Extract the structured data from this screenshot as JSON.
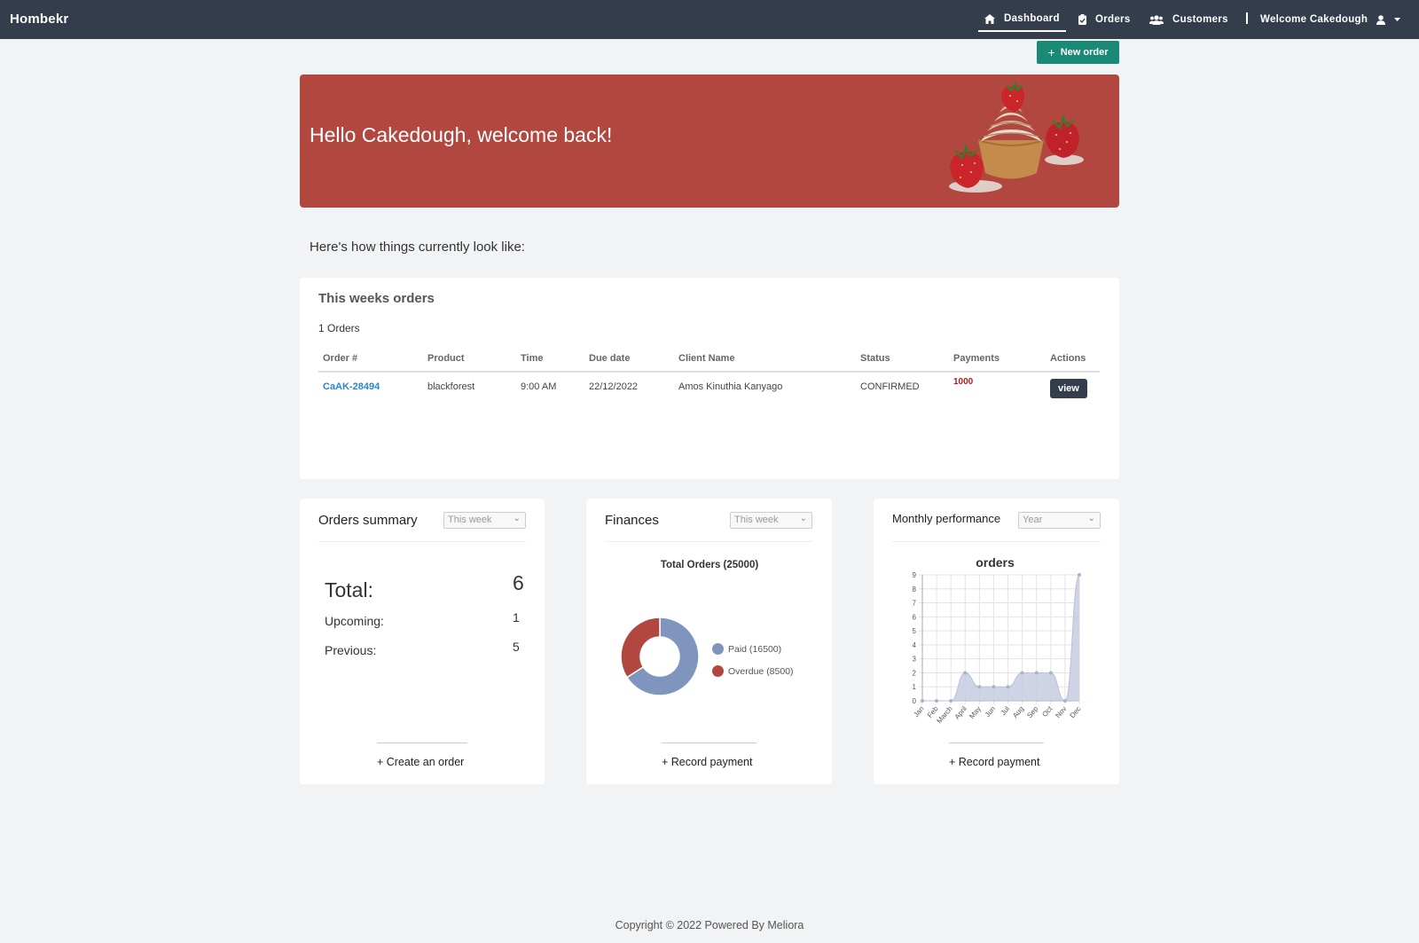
{
  "nav": {
    "brand": "Hombekr",
    "dashboard": "Dashboard",
    "orders": "Orders",
    "customers": "Customers",
    "welcome": "Welcome Cakedough"
  },
  "actions": {
    "new_order": "New order"
  },
  "banner": {
    "greeting": "Hello Cakedough, welcome back!"
  },
  "subtitle": "Here's how things currently look like:",
  "orders_card": {
    "title": "This weeks orders",
    "count": "1 Orders",
    "columns": [
      "Order #",
      "Product",
      "Time",
      "Due date",
      "Client Name",
      "Status",
      "Payments",
      "Actions"
    ],
    "rows": [
      {
        "order": "CaAK-28494",
        "product": "blackforest",
        "time": "9:00 AM",
        "due": "22/12/2022",
        "client": "Amos Kinuthia Kanyago",
        "status": "CONFIRMED",
        "payment": "1000",
        "action": "view"
      }
    ]
  },
  "summary": {
    "title": "Orders summary",
    "filter": "This week",
    "total_label": "Total:",
    "total": "6",
    "upcoming_label": "Upcoming:",
    "upcoming": "1",
    "previous_label": "Previous:",
    "previous": "5",
    "footer": "+ Create an order"
  },
  "finances": {
    "title": "Finances",
    "filter": "This week",
    "footer": "+ Record payment"
  },
  "performance": {
    "title": "Monthly performance",
    "filter": "Year",
    "footer": "+ Record payment"
  },
  "chart_data": [
    {
      "type": "pie",
      "title": "Total Orders (25000)",
      "categories": [
        "Paid (16500)",
        "Overdue (8500)"
      ],
      "values": [
        16500,
        8500
      ],
      "colors": [
        "#7f95bd",
        "#b2473f"
      ],
      "legend": "right"
    },
    {
      "type": "area",
      "title": "orders",
      "categories": [
        "Jan",
        "Feb",
        "March",
        "April",
        "May",
        "Jun",
        "Jul",
        "Aug",
        "Sep",
        "Oct",
        "Nov",
        "Dec"
      ],
      "series": [
        {
          "values": [
            0,
            0,
            0,
            2,
            1,
            1,
            1,
            2,
            2,
            2,
            0,
            9
          ]
        }
      ],
      "ylim": [
        0,
        9
      ],
      "yticks": [
        "0",
        "1",
        "2",
        "3",
        "4",
        "5",
        "6",
        "7",
        "8",
        "9"
      ],
      "grid": true,
      "color": "#c5cde0"
    }
  ],
  "footer": "Copyright © 2022 Powered By Meliora"
}
